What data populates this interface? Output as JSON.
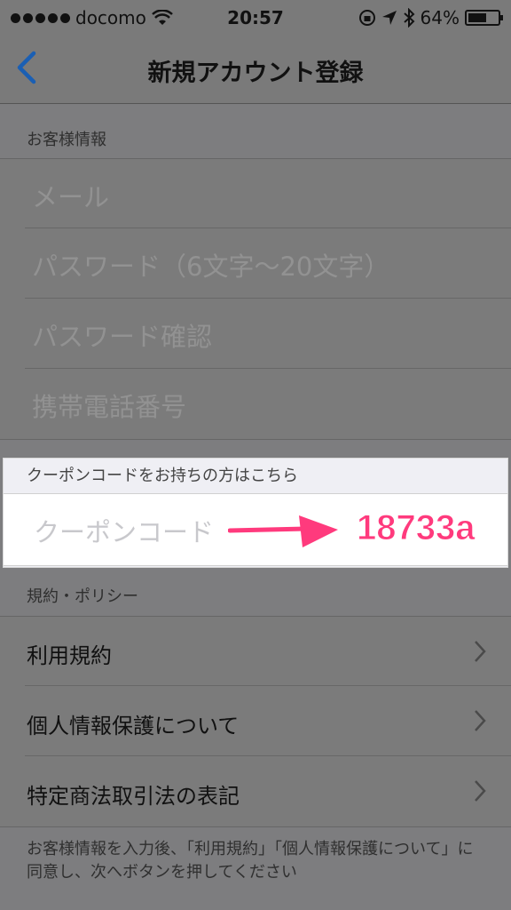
{
  "status_bar": {
    "carrier": "docomo",
    "time": "20:57",
    "battery": "64%",
    "battery_level": 0.64
  },
  "nav": {
    "title": "新規アカウント登録"
  },
  "customer_section": {
    "header": "お客様情報",
    "fields": [
      {
        "placeholder": "メール"
      },
      {
        "placeholder": "パスワード（6文字〜20文字）"
      },
      {
        "placeholder": "パスワード確認"
      },
      {
        "placeholder": "携帯電話番号"
      }
    ]
  },
  "coupon_section": {
    "header": "クーポンコードをお持ちの方はこちら",
    "field_placeholder": "クーポンコード",
    "annotation_code": "18733a",
    "annotation_color": "#ff3a7d"
  },
  "policy_section": {
    "header": "規約・ポリシー",
    "items": [
      {
        "label": "利用規約"
      },
      {
        "label": "個人情報保護について"
      },
      {
        "label": "特定商法取引法の表記"
      }
    ]
  },
  "footer_note": "お客様情報を入力後、「利用規約」「個人情報保護について」に同意し、次へボタンを押してください",
  "colors": {
    "accent": "#1a5fb4",
    "overlay": "#7b7b7b"
  }
}
